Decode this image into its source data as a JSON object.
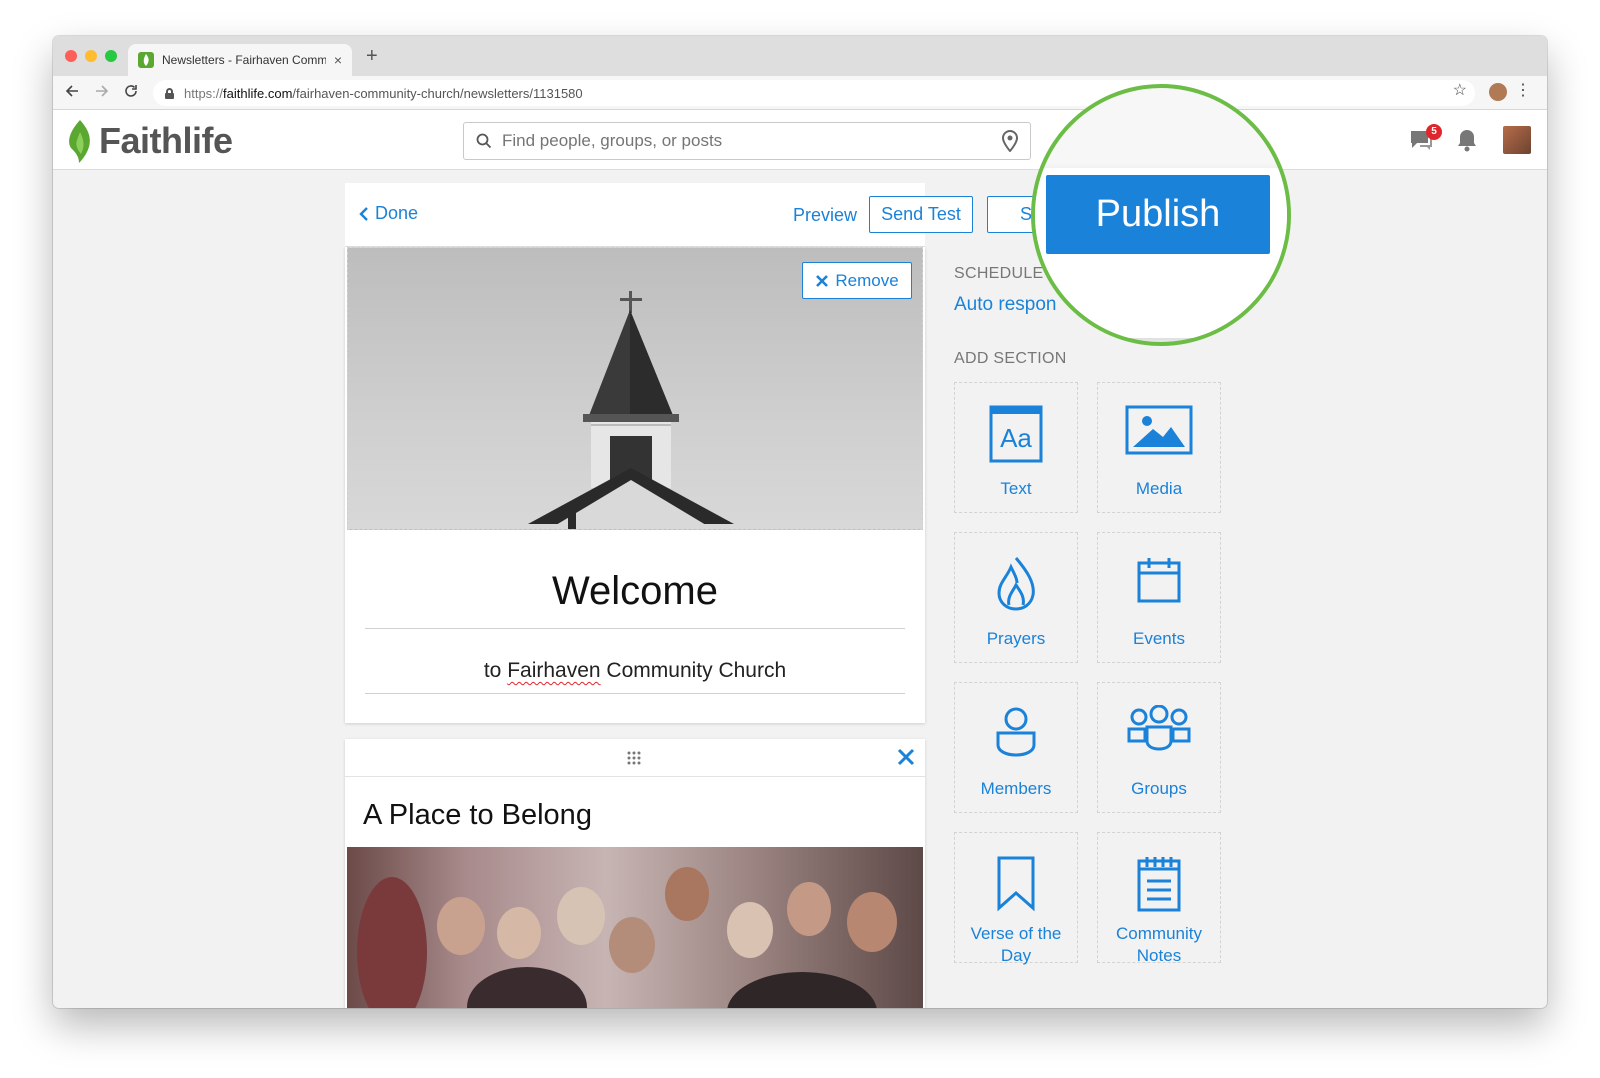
{
  "browser": {
    "tab_title": "Newsletters - Fairhaven Comm",
    "tab_close": "×",
    "new_tab": "+",
    "url_domain": "faithlife.com",
    "url_prefix": "https://",
    "url_path": "/fairhaven-community-church/newsletters/1131580"
  },
  "header": {
    "logo_text": "Faithlife",
    "search_placeholder": "Find people, groups, or posts",
    "notification_count": "5"
  },
  "editor": {
    "done_label": "Done",
    "preview_label": "Preview",
    "send_test_label": "Send Test",
    "cut_button_label": "S",
    "publish_label": "Publish",
    "remove_label": "Remove",
    "welcome_title": "Welcome",
    "subtitle_prefix": "to ",
    "subtitle_misspelled": "Fairhaven",
    "subtitle_suffix": " Community Church",
    "section_title": "A Place to Belong"
  },
  "sidebar": {
    "schedule_label": "SCHEDULE",
    "schedule_link": "Auto respon",
    "add_section_label": "ADD SECTION",
    "tiles": [
      {
        "label": "Text",
        "icon": "text-icon"
      },
      {
        "label": "Media",
        "icon": "media-icon"
      },
      {
        "label": "Prayers",
        "icon": "prayers-icon"
      },
      {
        "label": "Events",
        "icon": "events-icon"
      },
      {
        "label": "Members",
        "icon": "members-icon"
      },
      {
        "label": "Groups",
        "icon": "groups-icon"
      },
      {
        "label": "Verse of the Day",
        "icon": "bookmark-icon"
      },
      {
        "label": "Community Notes",
        "icon": "notes-icon"
      }
    ]
  },
  "colors": {
    "accent": "#1a82d8",
    "highlight_ring": "#6cbd45",
    "badge": "#e0262c",
    "logo_green": "#5aa832"
  }
}
